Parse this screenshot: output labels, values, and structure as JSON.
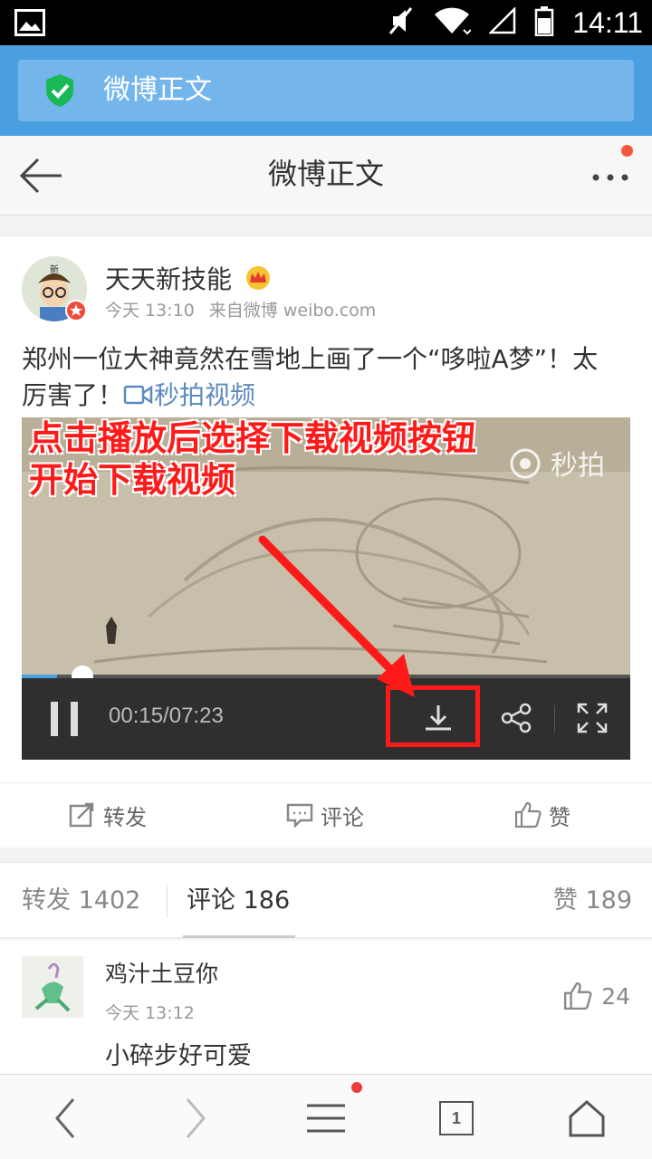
{
  "status_bar": {
    "time": "14:11"
  },
  "browser": {
    "url_title": "微博正文"
  },
  "header": {
    "title": "微博正文"
  },
  "post": {
    "author": "天天新技能",
    "time": "今天 13:10",
    "source": "来自微博 weibo.com",
    "text": "郑州一位大神竟然在雪地上画了一个“哆啦A梦”！太厉害了！",
    "video_link": "秒拍视频",
    "avatar_text": "新"
  },
  "video": {
    "overlay_line1": "点击播放后选择下载视频按钮",
    "overlay_line2": "开始下载视频",
    "watermark": "秒拍",
    "time": "00:15/07:23",
    "progress": 0.058
  },
  "actions": {
    "repost": "转发",
    "comment": "评论",
    "like": "赞"
  },
  "tabs": {
    "repost_label": "转发 1402",
    "comment_label": "评论 186",
    "like_label": "赞 189"
  },
  "comment": {
    "name": "鸡汁土豆你",
    "time": "今天 13:12",
    "text": "小碎步好可爱",
    "likes": "24"
  },
  "bottom_nav": {
    "tab_count": "1"
  },
  "colors": {
    "accent": "#4a9fe0",
    "annotation_red": "#ff1a1a",
    "badge_red": "#f5563c"
  }
}
